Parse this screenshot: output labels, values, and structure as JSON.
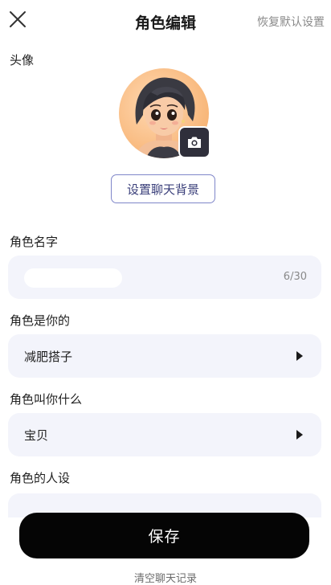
{
  "header": {
    "title": "角色编辑",
    "reset_label": "恢复默认设置"
  },
  "avatar": {
    "label": "头像",
    "set_background_label": "设置聊天背景"
  },
  "name": {
    "label": "角色名字",
    "count": "6/30"
  },
  "relation": {
    "label": "角色是你的",
    "value": "减肥搭子"
  },
  "nickname": {
    "label": "角色叫你什么",
    "value": "宝贝"
  },
  "persona": {
    "label": "角色的人设"
  },
  "actions": {
    "save_label": "保存",
    "clear_label": "清空聊天记录"
  }
}
